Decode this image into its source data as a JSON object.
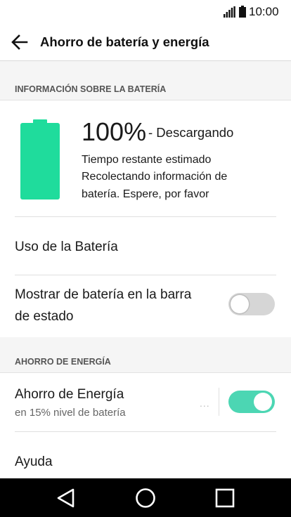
{
  "status_bar": {
    "time": "10:00",
    "icons": [
      "signal-icon",
      "battery-icon"
    ]
  },
  "app_bar": {
    "back_icon": "arrow-left-icon",
    "title": "Ahorro de batería y energía"
  },
  "battery_section": {
    "header": "INFORMACIÓN SOBRE LA BATERÍA",
    "level_percent": 100,
    "percent_text": "100%",
    "state": "- Descargando",
    "detail_lines": [
      "Tiempo restante estimado",
      "Recolectando información de",
      "batería. Espere, por favor"
    ],
    "battery_color": "#1fdc9c"
  },
  "items": {
    "battery_usage": {
      "title": "Uso de la Batería"
    },
    "show_battery_status_bar": {
      "title_lines": [
        "Mostrar de batería en la barra",
        "de estado"
      ],
      "toggle_on": false
    }
  },
  "energy_section": {
    "header": "AHORRO DE ENERGÍA",
    "energy_saver": {
      "title": "Ahorro de Energía",
      "subtitle": "en 15% nivel de batería",
      "more": "...",
      "toggle_on": true
    },
    "help": {
      "title": "Ayuda"
    }
  },
  "colors": {
    "accent": "#4cd6b3",
    "battery": "#1fdc9c",
    "section_bg": "#f5f5f5",
    "toggle_off": "#d6d6d6",
    "nav_bar": "#000000"
  },
  "nav_bar": {
    "buttons": [
      "back-triangle-icon",
      "home-circle-icon",
      "recents-square-icon"
    ]
  }
}
